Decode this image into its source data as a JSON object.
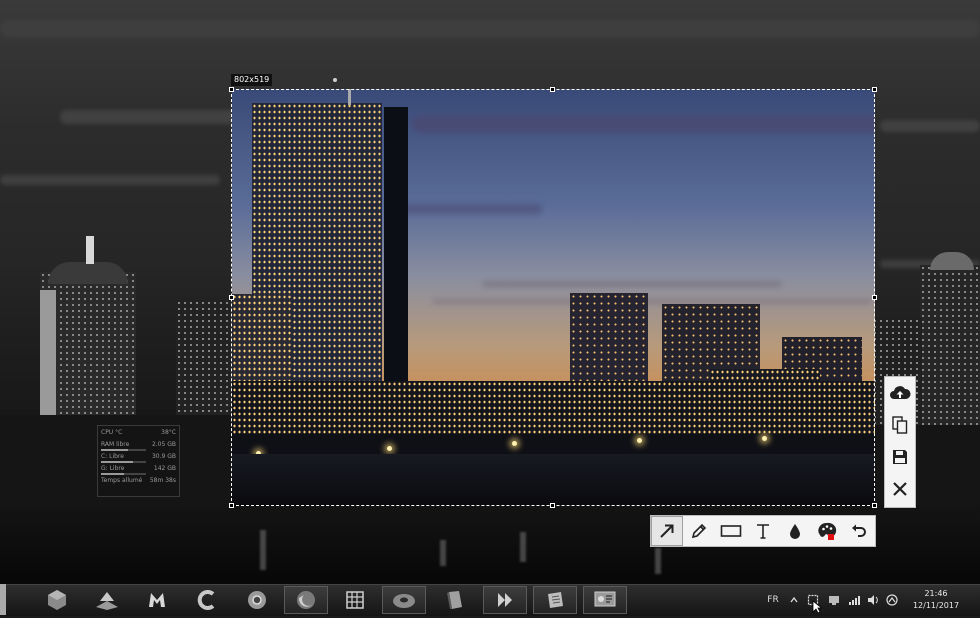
{
  "selection": {
    "size_label": "802x519"
  },
  "action_toolbar": [
    "upload-icon",
    "copy-icon",
    "save-icon",
    "close-icon"
  ],
  "draw_toolbar": [
    "arrow-icon",
    "pencil-icon",
    "rectangle-icon",
    "text-icon",
    "blur-icon",
    "color-palette-icon",
    "undo-icon"
  ],
  "sysinfo": {
    "rows": [
      {
        "label": "CPU °C",
        "value": "38°C"
      },
      {
        "label": "RAM libre",
        "value": "2.05 GB"
      },
      {
        "label": "C: Libre",
        "value": "30.9 GB"
      },
      {
        "label": "G: Libre",
        "value": "142 GB"
      },
      {
        "label": "Temps allumé",
        "value": "58m 38s"
      }
    ]
  },
  "tray": {
    "language": "FR"
  },
  "clock": {
    "time": "21:46",
    "date": "12/11/2017"
  },
  "colors": {
    "palette_swatch": "#e01010",
    "toolbar_bg": "#f4f4f4"
  }
}
